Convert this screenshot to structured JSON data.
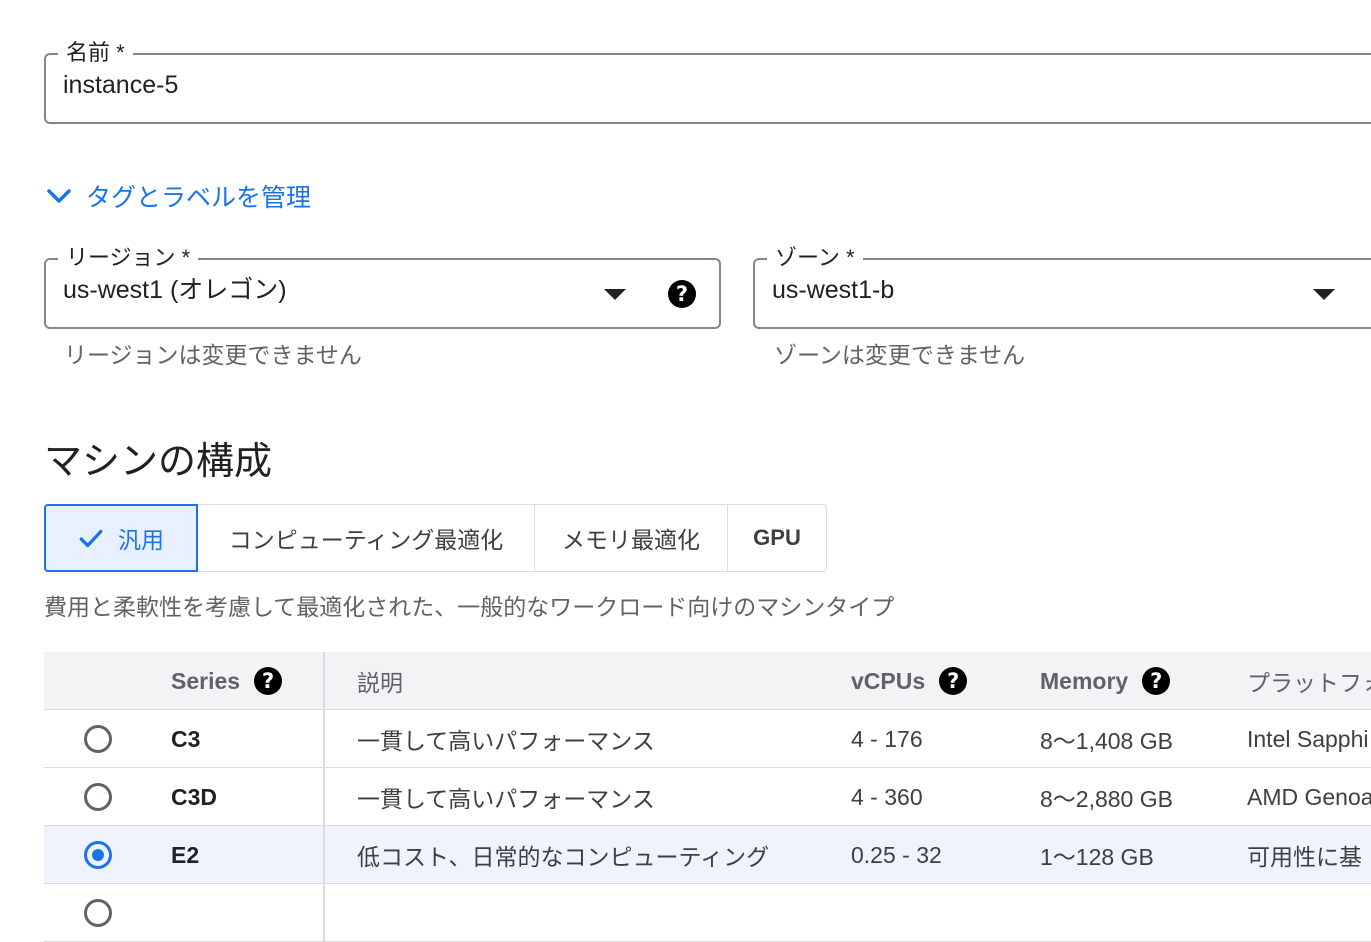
{
  "name_field": {
    "label": "名前 *",
    "value": "instance-5"
  },
  "tags_link": {
    "label": "タグとラベルを管理"
  },
  "region_field": {
    "label": "リージョン *",
    "value": "us-west1 (オレゴン)",
    "hint": "リージョンは変更できません"
  },
  "zone_field": {
    "label": "ゾーン *",
    "value": "us-west1-b",
    "hint": "ゾーンは変更できません"
  },
  "machine_section": {
    "title": "マシンの構成",
    "tabs": [
      {
        "label": "汎用",
        "selected": true
      },
      {
        "label": "コンピューティング最適化"
      },
      {
        "label": "メモリ最適化"
      },
      {
        "label": "GPU"
      }
    ],
    "description": "費用と柔軟性を考慮して最適化された、一般的なワークロード向けのマシンタイプ"
  },
  "series_table": {
    "headers": {
      "series": "Series",
      "description": "説明",
      "vcpus": "vCPUs",
      "memory": "Memory",
      "platform": "プラットフォ"
    },
    "rows": [
      {
        "series": "C3",
        "description": "一貫して高いパフォーマンス",
        "vcpus": "4 - 176",
        "memory": "8〜1,408 GB",
        "platform": "Intel Sapphi",
        "selected": false
      },
      {
        "series": "C3D",
        "description": "一貫して高いパフォーマンス",
        "vcpus": "4 - 360",
        "memory": "8〜2,880 GB",
        "platform": "AMD Genoa",
        "selected": false
      },
      {
        "series": "E2",
        "description": "低コスト、日常的なコンピューティング",
        "vcpus": "0.25 - 32",
        "memory": "1〜128 GB",
        "platform": "可用性に基",
        "selected": true
      }
    ]
  },
  "colors": {
    "accent": "#1a73e8",
    "border": "#80868b",
    "text": "#202124"
  },
  "icons": {
    "expand": "chevron-down-icon",
    "help": "help-icon",
    "check": "check-icon",
    "dropdown": "dropdown-arrow-icon"
  }
}
